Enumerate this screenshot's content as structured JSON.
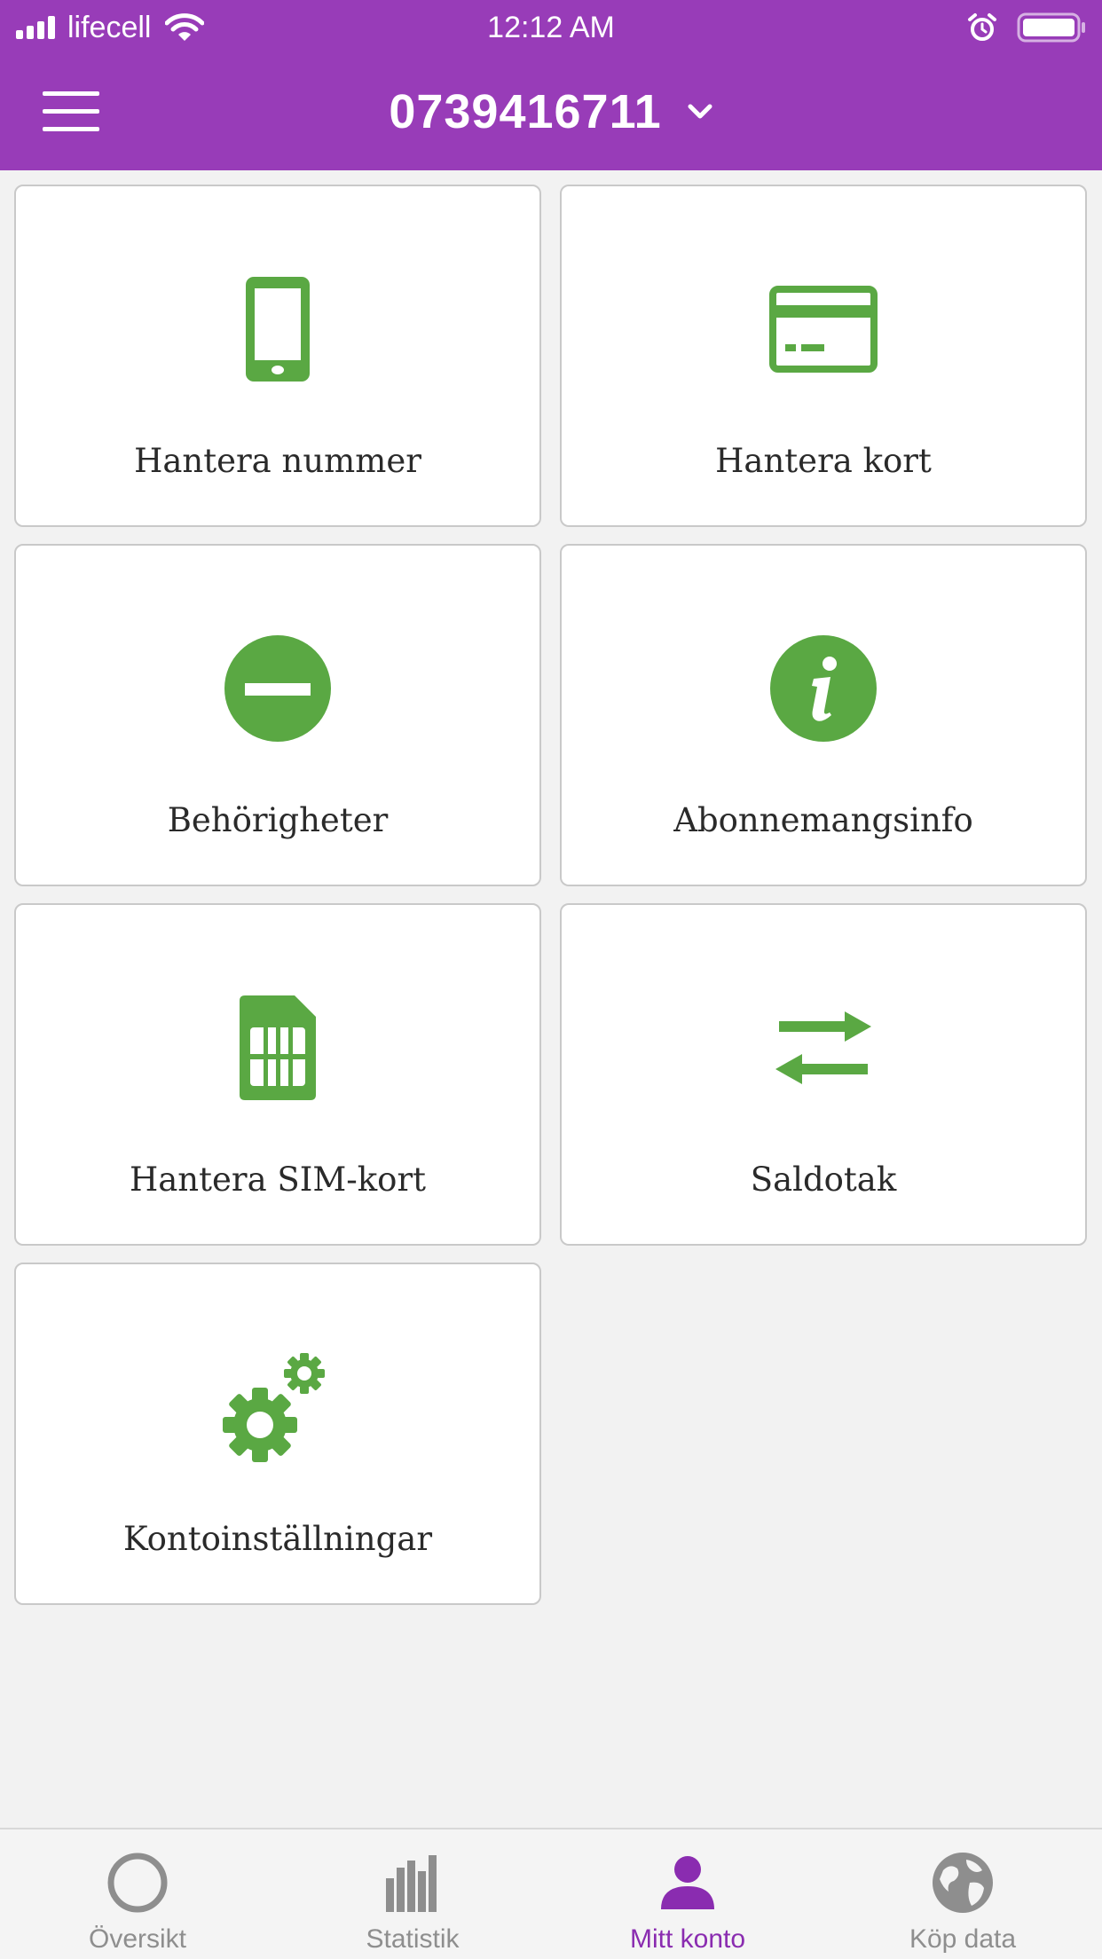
{
  "status_bar": {
    "carrier": "lifecell",
    "time": "12:12 AM",
    "icons": [
      "signal-icon",
      "wifi-icon",
      "alarm-icon",
      "battery-icon"
    ]
  },
  "header": {
    "phone_number": "0739416711",
    "icons": [
      "menu-icon",
      "chevron-down-icon"
    ]
  },
  "tiles": [
    {
      "label": "Hantera nummer",
      "icon": "smartphone-icon"
    },
    {
      "label": "Hantera kort",
      "icon": "credit-card-icon"
    },
    {
      "label": "Behörigheter",
      "icon": "no-entry-icon"
    },
    {
      "label": "Abonnemangsinfo",
      "icon": "info-icon"
    },
    {
      "label": "Hantera SIM-kort",
      "icon": "sim-card-icon"
    },
    {
      "label": "Saldotak",
      "icon": "transfer-arrows-icon"
    },
    {
      "label": "Kontoinställningar",
      "icon": "gears-icon"
    }
  ],
  "tab_bar": {
    "tabs": [
      {
        "label": "Översikt",
        "icon": "circle-icon",
        "active": false
      },
      {
        "label": "Statistik",
        "icon": "bar-chart-icon",
        "active": false
      },
      {
        "label": "Mitt konto",
        "icon": "user-icon",
        "active": true
      },
      {
        "label": "Köp data",
        "icon": "globe-icon",
        "active": false
      }
    ]
  },
  "colors": {
    "brand_purple": "#983cb8",
    "active_tab_purple": "#8a2cb0",
    "icon_green": "#5aa843",
    "inactive_gray": "#8e8e8e",
    "background": "#f2f2f2"
  }
}
